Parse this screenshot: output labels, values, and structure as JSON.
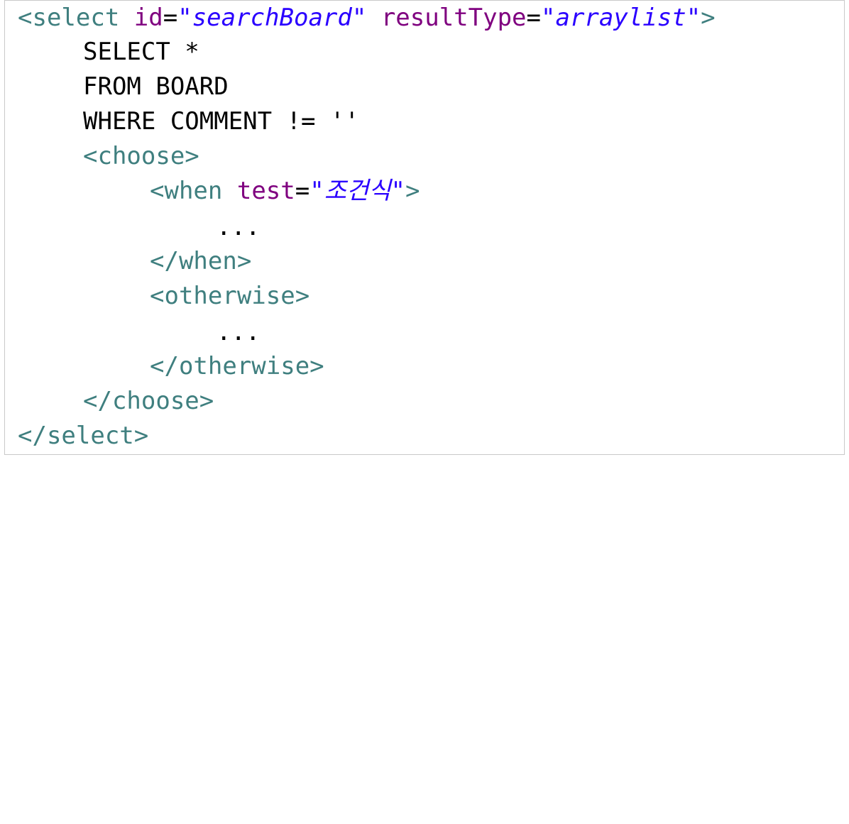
{
  "code": {
    "l1": {
      "open": "<select",
      "attr1": "id",
      "eq1": "=",
      "val1": "\"searchBoard\"",
      "attr2": "resultType",
      "eq2": "=",
      "val2": "\"arraylist\"",
      "close": ">"
    },
    "l2": "SELECT *",
    "l3": "FROM BOARD",
    "l4": "WHERE COMMENT != ''",
    "l5": "<choose>",
    "l6": {
      "open": "<when",
      "attr": "test",
      "eq": "=",
      "val": "\"조건식\"",
      "close": ">"
    },
    "l7": "...",
    "l8": "</when>",
    "l9": "<otherwise>",
    "l10": "...",
    "l11": "</otherwise>",
    "l12": "</choose>",
    "l13": "</select>"
  },
  "colors": {
    "tag": "#3f7f7f",
    "attribute": "#7f007f",
    "value": "#2a00ff",
    "text": "#000000",
    "border": "#c9c9c9"
  }
}
